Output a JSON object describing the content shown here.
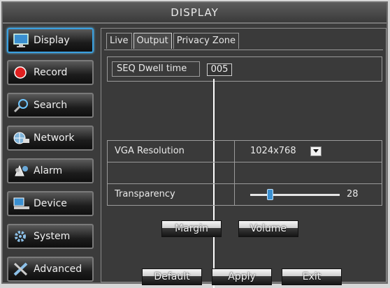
{
  "window": {
    "title": "DISPLAY"
  },
  "sidebar": {
    "items": [
      {
        "label": "Display",
        "icon": "monitor-icon",
        "active": true
      },
      {
        "label": "Record",
        "icon": "record-icon",
        "active": false
      },
      {
        "label": "Search",
        "icon": "search-icon",
        "active": false
      },
      {
        "label": "Network",
        "icon": "network-icon",
        "active": false
      },
      {
        "label": "Alarm",
        "icon": "alarm-icon",
        "active": false
      },
      {
        "label": "Device",
        "icon": "device-icon",
        "active": false
      },
      {
        "label": "System",
        "icon": "gear-icon",
        "active": false
      },
      {
        "label": "Advanced",
        "icon": "wrench-icon",
        "active": false
      }
    ]
  },
  "tabs": [
    {
      "label": "Live",
      "active": false
    },
    {
      "label": "Output",
      "active": true
    },
    {
      "label": "Privacy Zone",
      "active": false
    }
  ],
  "seq": {
    "label": "SEQ Dwell time",
    "value": "005"
  },
  "settings": {
    "vga": {
      "label": "VGA Resolution",
      "value": "1024x768"
    },
    "transparency": {
      "label": "Transparency",
      "value": "28",
      "level_percent": 22
    }
  },
  "buttons": {
    "margin": "Margin",
    "volume": "Volume",
    "default": "Default",
    "apply": "Apply",
    "exit": "Exit"
  },
  "colors": {
    "accent": "#3aa0e0",
    "panel": "#3a3a3a"
  }
}
